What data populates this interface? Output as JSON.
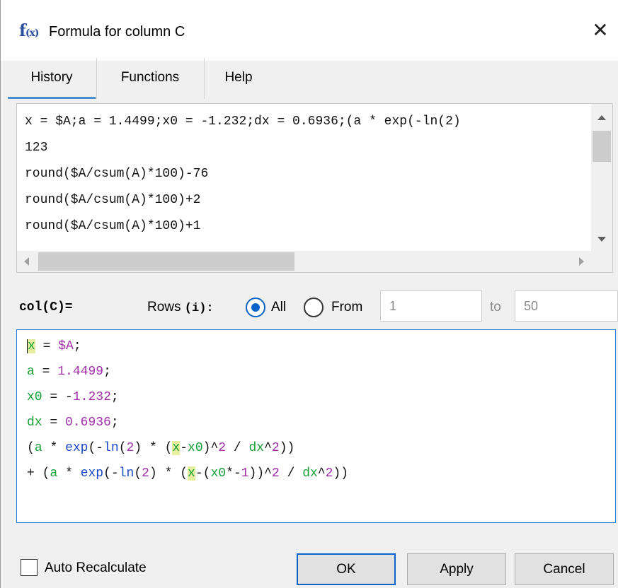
{
  "window": {
    "icon_text": "f",
    "icon_sub": "(x)",
    "title": "Formula for column C"
  },
  "tabs": [
    {
      "label": "History",
      "active": true
    },
    {
      "label": "Functions",
      "active": false
    },
    {
      "label": "Help",
      "active": false
    }
  ],
  "history": {
    "lines": [
      "x = $A;a = 1.4499;x0 = -1.232;dx = 0.6936;(a * exp(-ln(2)",
      "123",
      "round($A/csum(A)*100)-76",
      "round($A/csum(A)*100)+2",
      "round($A/csum(A)*100)+1"
    ]
  },
  "rows": {
    "col_label": "col(C)=",
    "rows_text": "Rows ",
    "rows_var": "(i):",
    "all_label": "All",
    "from_label": "From",
    "all_selected": true,
    "from_value": "1",
    "to_label": "to",
    "to_value": "50"
  },
  "formula": {
    "lines": [
      "x = $A;",
      "a = 1.4499;",
      "x0 = -1.232;",
      "dx = 0.6936;",
      "(a * exp(-ln(2) * (x-x0)^2 / dx^2))",
      "+ (a * exp(-ln(2) * (x-(x0*-1))^2 / dx^2))"
    ]
  },
  "footer": {
    "auto_recalc_label": "Auto Recalculate",
    "auto_recalc_checked": false,
    "ok_label": "OK",
    "apply_label": "Apply",
    "cancel_label": "Cancel"
  },
  "colors": {
    "accent": "#0a64c8",
    "variable": "#16a035",
    "number": "#a02fa8",
    "function": "#1c48c8",
    "highlight": "#e6ef9e"
  }
}
